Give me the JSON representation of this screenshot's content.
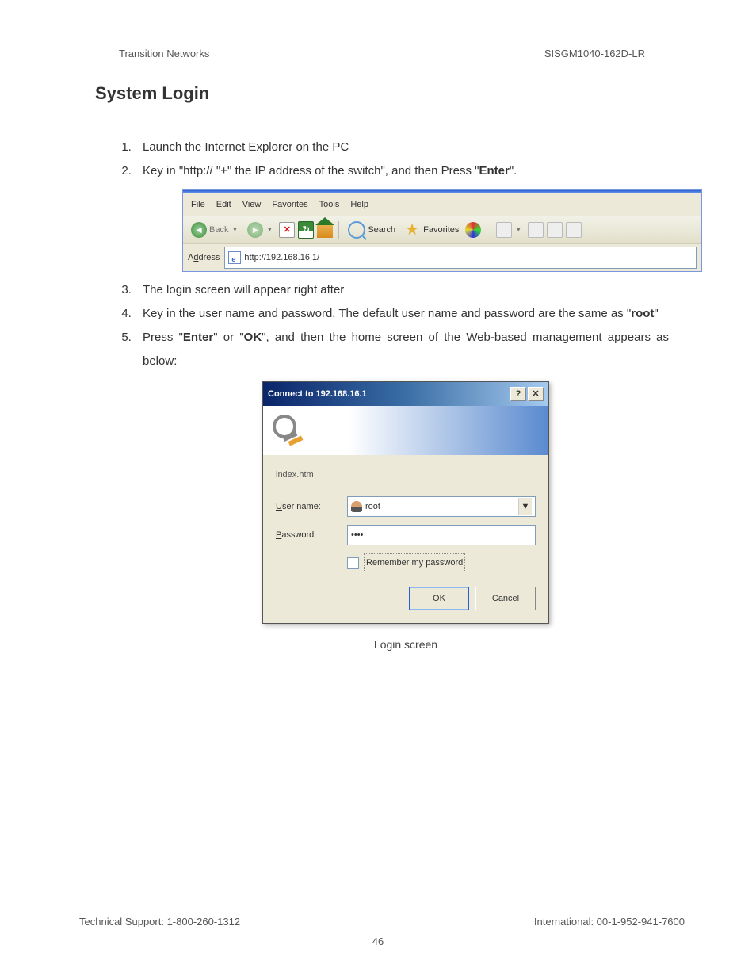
{
  "header": {
    "left": "Transition Networks",
    "right": "SISGM1040-162D-LR"
  },
  "title": "System Login",
  "steps": {
    "s1": "Launch the Internet Explorer on the PC",
    "s2_pre": "Key in \"http:// \"+\" the IP address of the switch\", and then Press \"",
    "s2_bold": "Enter",
    "s2_post": "\".",
    "s3": "The login screen will appear right after",
    "s4_pre": "Key in the user name and password. The default user name and password are the same as \"",
    "s4_bold": "root",
    "s4_post": "\"",
    "s5_pre": "Press \"",
    "s5_b1": "Enter",
    "s5_mid": "\" or \"",
    "s5_b2": "OK",
    "s5_post": "\", and then the home screen of the Web-based management appears as below:"
  },
  "ie": {
    "menu": {
      "file": "File",
      "edit": "Edit",
      "view": "View",
      "favorites": "Favorites",
      "tools": "Tools",
      "help": "Help"
    },
    "toolbar": {
      "back": "Back",
      "search": "Search",
      "favorites": "Favorites"
    },
    "address_label_pre": "A",
    "address_label_u": "d",
    "address_label_post": "dress",
    "url": "http://192.168.16.1/"
  },
  "dialog": {
    "title": "Connect to 192.168.16.1",
    "realm": "index.htm",
    "user_label_u": "U",
    "user_label": "ser name:",
    "pass_label_u": "P",
    "pass_label": "assword:",
    "user_value": "root",
    "pass_value": "••••",
    "remember_u": "R",
    "remember": "emember my password",
    "ok": "OK",
    "cancel": "Cancel"
  },
  "caption": "Login screen",
  "footer": {
    "left": "Technical Support: 1-800-260-1312",
    "right": "International: 00-1-952-941-7600",
    "page": "46"
  }
}
